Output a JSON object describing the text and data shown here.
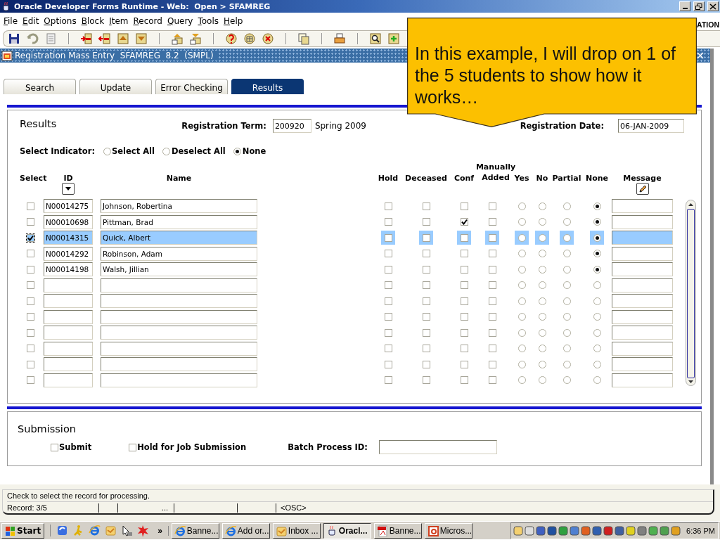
{
  "window": {
    "title": "Oracle Developer Forms Runtime - Web:  Open > SFAMREG"
  },
  "menu": [
    "File",
    "Edit",
    "Options",
    "Block",
    "Item",
    "Record",
    "Query",
    "Tools",
    "Help"
  ],
  "brand_fragment": "ATION",
  "form": {
    "title": "Registration Mass Entry  SFAMREG  8.2  (SMPL)"
  },
  "tabs": [
    {
      "label": "Search",
      "selected": false
    },
    {
      "label": "Update",
      "selected": false
    },
    {
      "label": "Error Checking",
      "selected": false
    },
    {
      "label": "Results",
      "selected": true
    }
  ],
  "results": {
    "heading": "Results",
    "term_label": "Registration Term:",
    "term": "200920",
    "term_description": "Spring 2009",
    "date_label": "Registration Date:",
    "date": "06-JAN-2009",
    "indicator_label": "Select Indicator:",
    "indicator_options": [
      {
        "label": "Select All",
        "selected": false
      },
      {
        "label": "Deselect All",
        "selected": false
      },
      {
        "label": "None",
        "selected": true
      }
    ],
    "columns": [
      "Select",
      "ID",
      "Name",
      "Hold",
      "Deceased",
      "Conf",
      "Manually Added",
      "Yes",
      "No",
      "Partial",
      "None",
      "Message"
    ],
    "rows": [
      {
        "select": false,
        "id": "N00014275",
        "name": "Johnson, Robertina",
        "hold": false,
        "deceased": false,
        "conf": false,
        "manually_added": false,
        "yes": false,
        "no": false,
        "partial": false,
        "none": true,
        "current": false
      },
      {
        "select": false,
        "id": "N00010698",
        "name": "Pittman, Brad",
        "hold": false,
        "deceased": false,
        "conf": true,
        "manually_added": false,
        "yes": false,
        "no": false,
        "partial": false,
        "none": true,
        "current": false
      },
      {
        "select": true,
        "id": "N00014315",
        "name": "Quick, Albert",
        "hold": false,
        "deceased": false,
        "conf": false,
        "manually_added": false,
        "yes": false,
        "no": false,
        "partial": false,
        "none": true,
        "current": true
      },
      {
        "select": false,
        "id": "N00014292",
        "name": "Robinson, Adam",
        "hold": false,
        "deceased": false,
        "conf": false,
        "manually_added": false,
        "yes": false,
        "no": false,
        "partial": false,
        "none": true,
        "current": false
      },
      {
        "select": false,
        "id": "N00014198",
        "name": "Walsh, Jillian",
        "hold": false,
        "deceased": false,
        "conf": false,
        "manually_added": false,
        "yes": false,
        "no": false,
        "partial": false,
        "none": true,
        "current": false
      },
      {
        "select": false,
        "hold": false,
        "deceased": false,
        "conf": false,
        "manually_added": false,
        "yes": false,
        "no": false,
        "partial": false,
        "none": false,
        "current": false
      },
      {
        "select": false,
        "hold": false,
        "deceased": false,
        "conf": false,
        "manually_added": false,
        "yes": false,
        "no": false,
        "partial": false,
        "none": false,
        "current": false
      },
      {
        "select": false,
        "hold": false,
        "deceased": false,
        "conf": false,
        "manually_added": false,
        "yes": false,
        "no": false,
        "partial": false,
        "none": false,
        "current": false
      },
      {
        "select": false,
        "hold": false,
        "deceased": false,
        "conf": false,
        "manually_added": false,
        "yes": false,
        "no": false,
        "partial": false,
        "none": false,
        "current": false
      },
      {
        "select": false,
        "hold": false,
        "deceased": false,
        "conf": false,
        "manually_added": false,
        "yes": false,
        "no": false,
        "partial": false,
        "none": false,
        "current": false
      },
      {
        "select": false,
        "hold": false,
        "deceased": false,
        "conf": false,
        "manually_added": false,
        "yes": false,
        "no": false,
        "partial": false,
        "none": false,
        "current": false
      },
      {
        "select": false,
        "hold": false,
        "deceased": false,
        "conf": false,
        "manually_added": false,
        "yes": false,
        "no": false,
        "partial": false,
        "none": false,
        "current": false
      }
    ]
  },
  "submission": {
    "heading": "Submission",
    "options": [
      {
        "label": "Submit",
        "checked": false
      },
      {
        "label": "Hold for Job Submission",
        "checked": false
      }
    ],
    "batch_label": "Batch Process ID:"
  },
  "hint": "Check to select the record for processing.",
  "status": {
    "record": "Record: 3/5",
    "segment_3": "...",
    "segment_6": "<OSC>"
  },
  "taskbar": {
    "start": "Start",
    "more": "»",
    "tasks": [
      {
        "label": "Banne...",
        "selected": false
      },
      {
        "label": "Add or...",
        "selected": false
      },
      {
        "label": "Inbox ...",
        "selected": false
      },
      {
        "label": "Oracl...",
        "selected": true
      },
      {
        "label": "Banne...",
        "selected": false
      },
      {
        "label": "Micros...",
        "selected": false
      }
    ],
    "clock": "6:36 PM"
  },
  "callout": {
    "text": "In this example, I will drop on 1 of the 5 students to show how it works…"
  }
}
